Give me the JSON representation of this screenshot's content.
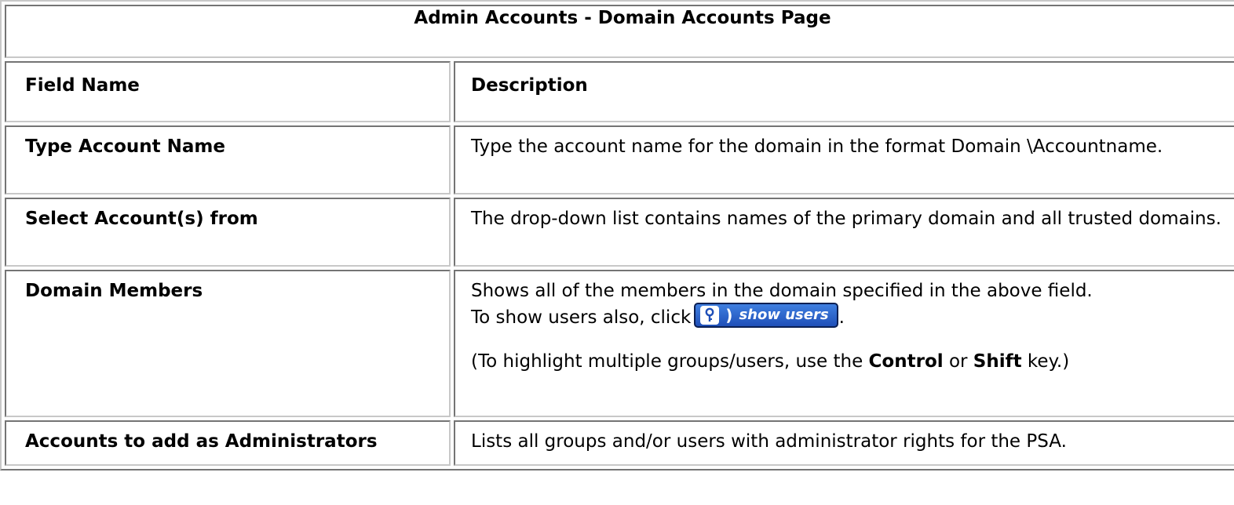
{
  "page": {
    "title": "Admin Accounts - Domain Accounts Page",
    "headers": {
      "field": "Field Name",
      "description": "Description"
    },
    "rows": {
      "type_account": {
        "field": "Type Account Name",
        "description": "Type the account name for the domain in the format Domain \\Accountname."
      },
      "select_account": {
        "field": "Select Account(s) from",
        "description": "The drop-down list contains names of the primary domain and all trusted domains."
      },
      "domain_members": {
        "field": "Domain Members",
        "description_line1": "Shows all of the members in the domain specified in the above field.",
        "description_line2_prefix": "To show users also, click",
        "description_line2_suffix": ".",
        "button_label": "show users",
        "note_prefix": "(To highlight multiple groups/users, use the",
        "note_key1": "Control",
        "note_mid": "or",
        "note_key2": "Shift",
        "note_suffix": "key.)"
      },
      "accounts_to_add": {
        "field": "Accounts to add as Administrators",
        "description": "Lists all groups and/or users with administrator rights for the PSA."
      }
    }
  },
  "icons": {
    "show_users_icon": "key-icon"
  },
  "colors": {
    "button_blue": "#2b5fcf",
    "button_border": "#0b1f52",
    "border_gray": "#c8c8c8"
  }
}
